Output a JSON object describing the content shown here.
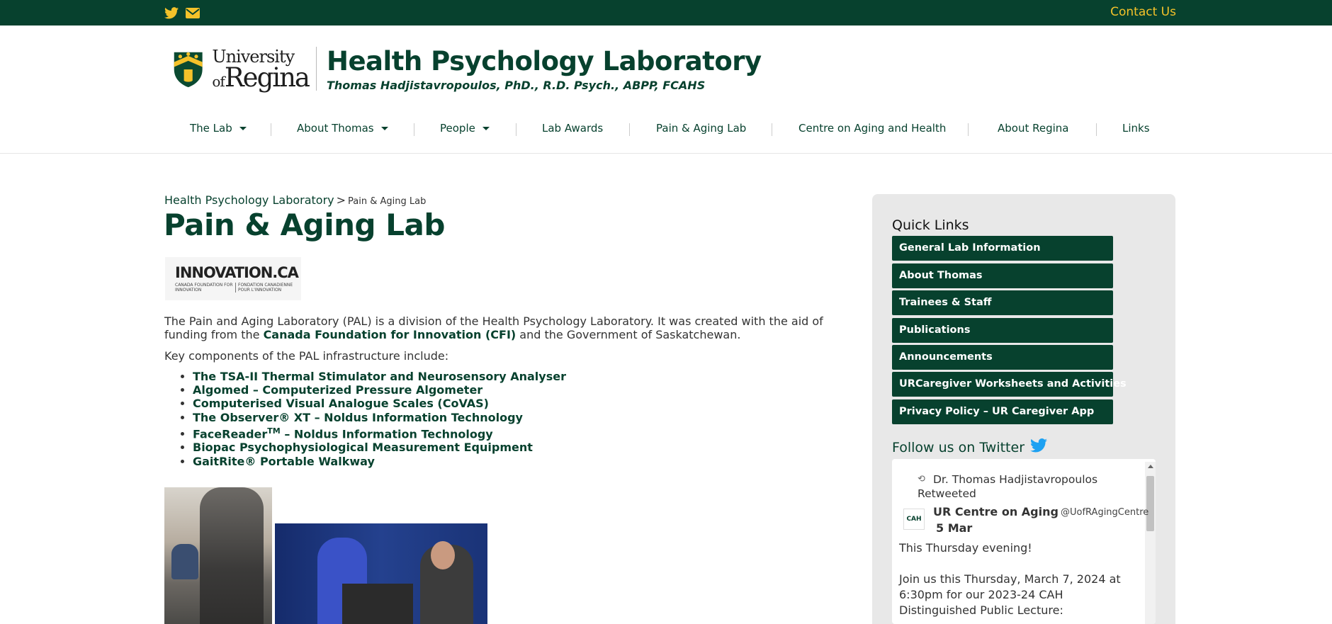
{
  "topbar": {
    "twitter_icon": "twitter-icon",
    "mail_icon": "envelope-icon",
    "contact_label": "Contact Us",
    "accent_color": "#f4c22a",
    "bar_color": "#07412e"
  },
  "header": {
    "logo_line1": "University",
    "logo_line2_of": "of",
    "logo_line2": "Regina",
    "title": "Health Psychology Laboratory",
    "subtitle": "Thomas Hadjistavropoulos, PhD., R.D. Psych., ABPP, FCAHS"
  },
  "nav": {
    "items": [
      {
        "label": "The Lab"
      },
      {
        "label": "About Thomas"
      },
      {
        "label": "People"
      },
      {
        "label": "Lab Awards"
      },
      {
        "label": "Pain & Aging Lab"
      },
      {
        "label": "Centre on Aging and Health"
      },
      {
        "label": "About Regina"
      },
      {
        "label": "Links"
      }
    ]
  },
  "breadcrumb": {
    "home": "Health Psychology Laboratory",
    "separator": ">",
    "current": "Pain & Aging Lab"
  },
  "page": {
    "title": "Pain & Aging Lab",
    "innovation_logo": {
      "brand": "INNOVATION.CA",
      "en": "CANADA FOUNDATION FOR INNOVATION",
      "fr": "FONDATION CANADIENNE POUR L'INNOVATION"
    },
    "intro_before": "The Pain and Aging Laboratory (PAL) is a division of the Health Psychology Laboratory. It was created with the aid of funding from the ",
    "intro_link": "Canada Foundation for Innovation (CFI)",
    "intro_after": " and the Government of Saskatchewan.",
    "key_components": "Key components of the PAL infrastructure include:",
    "components": [
      "The TSA-II Thermal Stimulator and Neurosensory Analyser",
      "Algomed – Computerized Pressure Algometer",
      "Computerised Visual Analogue Scales (CoVAS)",
      "The Observer® XT – Noldus Information Technology",
      "FaceReader",
      "Biopac Psychophysiological Measurement Equipment",
      "GaitRite® Portable Walkway"
    ],
    "facereader_sup": "TM",
    "facereader_rest": " – Noldus Information Technology"
  },
  "sidebar": {
    "quick_links_title": "Quick Links",
    "quick_links": [
      "General Lab Information",
      "About Thomas",
      "Trainees & Staff",
      "Publications",
      "Announcements",
      "URCaregiver Worksheets and Activities",
      "Privacy Policy – UR Caregiver App"
    ],
    "twitter_title": "Follow us on Twitter",
    "tweet": {
      "retweeted_by": "Dr. Thomas Hadjistavropoulos Retweeted",
      "author": "UR Centre on Aging",
      "handle": "@UofRAgingCentre",
      "date": "5 Mar",
      "text1": "This Thursday evening!",
      "text2": "Join us this Thursday, March 7, 2024 at 6:30pm for our 2023-24 CAH Distinguished Public Lecture:",
      "logo_text": "CAH"
    }
  }
}
